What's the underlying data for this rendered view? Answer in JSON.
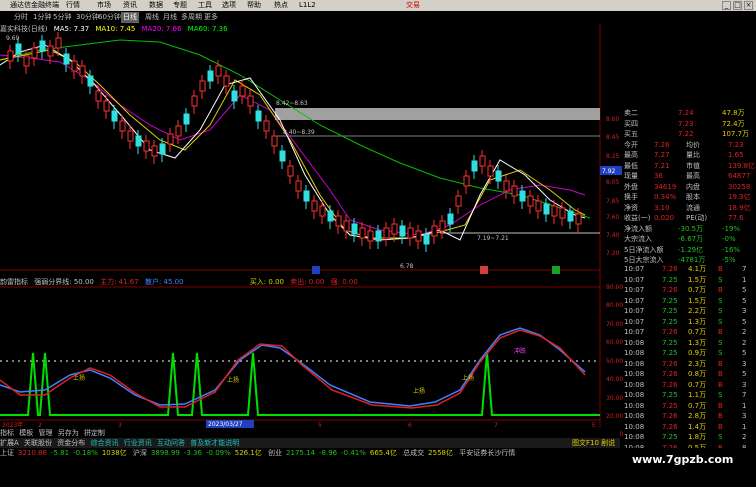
{
  "window": {
    "title": "通达信金融终端",
    "menus": [
      "行情",
      "市场",
      "资讯",
      "数据",
      "专题",
      "工具",
      "选项",
      "帮助",
      "热点",
      "L1L2"
    ],
    "brand": "交易",
    "controls": [
      "_",
      "□",
      "×"
    ]
  },
  "periods": {
    "items": [
      "分时",
      "1分钟",
      "5分钟",
      "30分钟",
      "60分钟",
      "日线",
      "周线",
      "月线",
      "多周期",
      "更多"
    ],
    "active": "日线"
  },
  "ma_line": {
    "stock": "嘉实科技(日线)",
    "ma5": "MA5: 7.37",
    "ma10": "MA10: 7.45",
    "ma20": "MA20: 7.66",
    "ma60": "MA60: 7.36"
  },
  "chart_labels": {
    "high": "9.69",
    "range1": "8.42~8.63",
    "range2": "8.40~8.39",
    "range3": "7.19~7.21",
    "low": "6.78",
    "current": "7.92"
  },
  "price_axis": [
    "8.60",
    "8.45",
    "8.25",
    "8.05",
    "7.85",
    "7.60",
    "7.40",
    "7.20"
  ],
  "indicator_line": {
    "name": "韵雷指标",
    "p1": "强弱分界线: 50.00",
    "p2": "主力: 41.67",
    "p3": "散户: 45.00",
    "p4": "买入: 0.00",
    "p5": "卖出: 0.00",
    "p6": "强: 0.00"
  },
  "ind_axis": [
    "90.00",
    "80.00",
    "70.00",
    "60.00",
    "50.00",
    "40.00",
    "30.00",
    "20.00",
    "10.00"
  ],
  "ind_labels": [
    "上扬",
    "上扬",
    "上扬",
    "上扬",
    "冲跌"
  ],
  "ind_ticks": [
    "2023年",
    "2",
    "3",
    "4",
    "5",
    "6",
    "7",
    "E"
  ],
  "date_label": "2023/03/27",
  "quote": {
    "rows": [
      [
        "卖二",
        "7.24",
        "47.8万"
      ],
      [
        "买四",
        "7.23",
        "72.4万"
      ],
      [
        "买五",
        "7.22",
        "107.7万"
      ],
      [
        "今开",
        "7.26",
        "均价",
        "7.23"
      ],
      [
        "最高",
        "7.27",
        "量比",
        "1.65"
      ],
      [
        "最低",
        "7.21",
        "市值",
        "139.8亿"
      ],
      [
        "现量",
        "36",
        "最高",
        "64877"
      ],
      [
        "外盘",
        "34619",
        "内盘",
        "30258"
      ],
      [
        "换手",
        "0.34%",
        "股本",
        "19.3亿"
      ],
      [
        "净资",
        "3.10",
        "流通",
        "18.9亿"
      ],
      [
        "收益(一)",
        "0.020",
        "PE(动)",
        "77.6"
      ],
      [
        "净流入额",
        "-30.5万",
        "-19%"
      ],
      [
        "大宗流入",
        "-6.67万",
        "-0%"
      ],
      [
        "5日净流入额",
        "-1.29亿",
        "-16%"
      ],
      [
        "5日大宗流入",
        "-4781万",
        "-5%"
      ]
    ]
  },
  "trades": [
    [
      "10:07",
      "7.26",
      "4.1万",
      "B",
      "7"
    ],
    [
      "10:07",
      "7.25",
      "1.5万",
      "S",
      "1"
    ],
    [
      "10:07",
      "7.26",
      "0.7万",
      "B",
      "5"
    ],
    [
      "10:07",
      "7.25",
      "1.5万",
      "S",
      "5"
    ],
    [
      "10:07",
      "7.25",
      "2.2万",
      "S",
      "3"
    ],
    [
      "10:07",
      "7.25",
      "1.3万",
      "S",
      "5"
    ],
    [
      "10:07",
      "7.26",
      "0.7万",
      "B",
      "2"
    ],
    [
      "10:08",
      "7.25",
      "1.3万",
      "S",
      "2"
    ],
    [
      "10:08",
      "7.25",
      "0.9万",
      "S",
      "5"
    ],
    [
      "10:08",
      "7.26",
      "2.3万",
      "B",
      "3"
    ],
    [
      "10:08",
      "7.26",
      "0.8万",
      "B",
      "5"
    ],
    [
      "10:08",
      "7.26",
      "0.7万",
      "B",
      "3"
    ],
    [
      "10:08",
      "7.25",
      "1.1万",
      "S",
      "7"
    ],
    [
      "10:08",
      "7.25",
      "0.7万",
      "B",
      "1"
    ],
    [
      "10:08",
      "7.26",
      "2.8万",
      "B",
      "3"
    ],
    [
      "10:08",
      "7.26",
      "1.4万",
      "B",
      "1"
    ],
    [
      "10:08",
      "7.25",
      "1.8万",
      "S",
      "2"
    ],
    [
      "10:08",
      "7.26",
      "0.5万",
      "B",
      "8"
    ]
  ],
  "tabs_row1": [
    "指标",
    "模板",
    "管理",
    "另存为",
    "拼定制"
  ],
  "tabs_row2": [
    "扩展A",
    "关联股份",
    "资金分布",
    "综合资讯",
    "行业资讯",
    "互动问答",
    "普及新才能说明"
  ],
  "tabs_right": "图文F10 剧说",
  "status": {
    "items": [
      [
        "上证",
        "3210.86",
        "-5.81",
        "-0.18%",
        "1038亿"
      ],
      [
        "沪深",
        "3898.99",
        "-3.36",
        "-0.09%",
        "526.1亿"
      ],
      [
        "创业",
        "2175.14",
        "-8.96",
        "-0.41%",
        "665.4亿"
      ],
      [
        "总成交",
        "2558亿"
      ],
      [
        "平安证券长沙行情"
      ]
    ]
  },
  "watermark": "www.7gpzb.com"
}
